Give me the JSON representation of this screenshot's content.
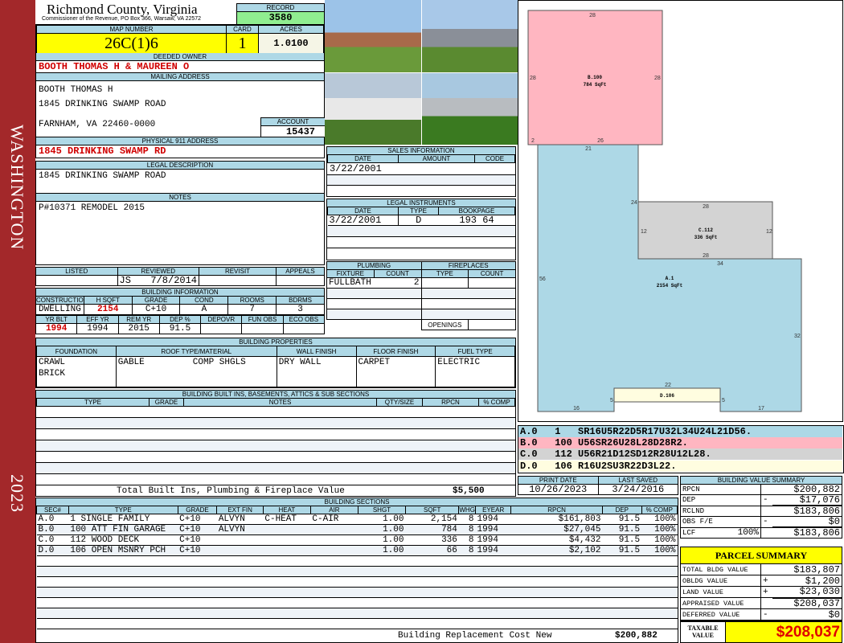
{
  "sidebar": {
    "district": "WASHINGTON",
    "year": "2023"
  },
  "header": {
    "title": "Richmond County, Virginia",
    "subtitle": "Commissioner of the Revenue, PO Box 366, Warsaw, VA 22572",
    "record_label": "RECORD",
    "record": "3580",
    "map_label": "MAP NUMBER",
    "map": "26C(1)6",
    "card_label": "CARD",
    "card": "1",
    "acres_label": "ACRES",
    "acres": "1.0100"
  },
  "owner": {
    "label": "DEEDED OWNER",
    "value": "BOOTH THOMAS H & MAUREEN O"
  },
  "mailing": {
    "label": "MAILING ADDRESS",
    "line1": "BOOTH THOMAS H",
    "line2": "1845 DRINKING SWAMP ROAD",
    "line3": "FARNHAM, VA 22460-0000",
    "account_label": "ACCOUNT",
    "account": "15437"
  },
  "physical": {
    "label": "PHYSICAL 911 ADDRESS",
    "value": "1845 DRINKING SWAMP RD"
  },
  "legal": {
    "label": "LEGAL DESCRIPTION",
    "value": "1845 DRINKING SWAMP ROAD"
  },
  "notes": {
    "label": "NOTES",
    "value": "P#10371 REMODEL 2015"
  },
  "review": {
    "headers": [
      "LISTED",
      "REVIEWED",
      "REVISIT",
      "APPEALS"
    ],
    "reviewer": "JS",
    "reviewed": "7/8/2014"
  },
  "building_info": {
    "label": "BUILDING INFORMATION",
    "h1": [
      "CONSTRUCTION STYLE",
      "H SQFT",
      "GRADE",
      "COND",
      "ROOMS",
      "BDRMS"
    ],
    "v1": [
      "DWELLING",
      "2154",
      "C+10",
      "A",
      "7",
      "3"
    ],
    "h2": [
      "YR BLT",
      "EFF YR",
      "REM YR",
      "DEP %",
      "DEPOVR",
      "FUN OBS",
      "ECO OBS"
    ],
    "v2": [
      "1994",
      "1994",
      "2015",
      "91.5",
      "",
      "",
      ""
    ]
  },
  "properties": {
    "label": "BUILDING PROPERTIES",
    "headers": [
      "FOUNDATION",
      "ROOF TYPE/MATERIAL",
      "WALL FINISH",
      "FLOOR FINISH",
      "FUEL TYPE"
    ],
    "foundation": [
      "CRAWL",
      "BRICK"
    ],
    "roof_type": "GABLE",
    "roof_material": "COMP SHGLS",
    "wall": "DRY WALL",
    "floor": "CARPET",
    "fuel": "ELECTRIC"
  },
  "builtins": {
    "label": "BUILDING BUILT INS, BASEMENTS, ATTICS & SUB SECTIONS",
    "headers": [
      "TYPE",
      "GRADE",
      "NOTES",
      "QTY/SIZE",
      "RPCN",
      "% COMP"
    ],
    "total_label": "Total Built Ins, Plumbing & Fireplace Value",
    "total": "$5,500"
  },
  "sales": {
    "label": "SALES INFORMATION",
    "headers": [
      "DATE",
      "AMOUNT",
      "CODE"
    ],
    "rows": [
      [
        "3/22/2001",
        "",
        ""
      ]
    ]
  },
  "instruments": {
    "label": "LEGAL INSTRUMENTS",
    "headers": [
      "DATE",
      "TYPE",
      "BOOKPAGE"
    ],
    "rows": [
      [
        "3/22/2001",
        "D",
        "193 64"
      ]
    ]
  },
  "plumbing": {
    "label": "PLUMBING",
    "headers": [
      "FIXTURE",
      "COUNT"
    ],
    "rows": [
      [
        "FULLBATH",
        "2"
      ]
    ]
  },
  "fireplaces": {
    "label": "FIREPLACES",
    "headers": [
      "TYPE",
      "COUNT"
    ],
    "openings_label": "OPENINGS"
  },
  "sections": {
    "label": "BUILDING SECTIONS",
    "headers": [
      "SEC#",
      "TYPE",
      "GRADE",
      "EXT FIN",
      "HEAT",
      "AIR",
      "SHGT",
      "SQFT",
      "WHGT",
      "EYEAR",
      "RPCN",
      "DEP",
      "% COMP"
    ],
    "rows": [
      [
        "A.0",
        "1 SINGLE FAMILY",
        "C+10",
        "ALVYN",
        "C-HEAT",
        "C-AIR",
        "1.00",
        "2,154",
        "8",
        "1994",
        "$161,803",
        "91.5",
        "100%"
      ],
      [
        "B.0",
        "100 ATT FIN GARAGE",
        "C+10",
        "ALVYN",
        "",
        "",
        "1.00",
        "784",
        "8",
        "1994",
        "$27,045",
        "91.5",
        "100%"
      ],
      [
        "C.0",
        "112 WOOD DECK",
        "C+10",
        "",
        "",
        "",
        "1.00",
        "336",
        "8",
        "1994",
        "$4,432",
        "91.5",
        "100%"
      ],
      [
        "D.0",
        "106 OPEN MSNRY PCH",
        "C+10",
        "",
        "",
        "",
        "1.00",
        "66",
        "8",
        "1994",
        "$2,102",
        "91.5",
        "100%"
      ]
    ],
    "rcn_label": "Building Replacement Cost New",
    "rcn": "$200,882"
  },
  "sketch": {
    "colors": {
      "A": "#add8e6",
      "B": "#ffb6c1",
      "C": "#d3d3d3",
      "D": "#fffde0"
    },
    "labels": {
      "A": [
        "A.1",
        "2154 SqFt"
      ],
      "B": [
        "B.100",
        "784 SqFt"
      ],
      "C": [
        "C.112",
        "336 SqFt"
      ],
      "D": [
        "D.106"
      ]
    },
    "dims": {
      "b_top": "28",
      "b_left": "28",
      "b_right": "28",
      "b_bot2": "2",
      "b_bot": "26",
      "a_top": "21",
      "a_24": "24",
      "c_top": "28",
      "c_left": "12",
      "c_right": "12",
      "c_bot": "28",
      "a_34": "34",
      "a_left": "56",
      "a_right": "32",
      "d_top": "22",
      "d_l": "5",
      "d_r": "5",
      "a_b1": "16",
      "a_b2": "17"
    },
    "legend": [
      [
        "A.0",
        "1",
        "SR16U5R22D5R17U32L34U24L21D56."
      ],
      [
        "B.0",
        "100",
        "U56SR26U28L28D28R2."
      ],
      [
        "C.0",
        "112",
        "U56R21D12SD12R28U12L28."
      ],
      [
        "D.0",
        "106",
        "R16U2SU3R22D3L22."
      ]
    ]
  },
  "dates": {
    "print_label": "PRINT DATE",
    "print": "10/26/2023",
    "saved_label": "LAST SAVED",
    "saved": "3/24/2016"
  },
  "value_summary": {
    "label": "BUILDING VALUE SUMMARY",
    "rows": [
      [
        "RPCN",
        "",
        "",
        "$200,882"
      ],
      [
        "DEP",
        "",
        "-",
        "$17,076"
      ],
      [
        "RCLND",
        "",
        "",
        "$183,806"
      ],
      [
        "OBS F/E",
        "",
        "-",
        "$0"
      ],
      [
        "LCF",
        "100%",
        "",
        "$183,806"
      ]
    ]
  },
  "parcel": {
    "label": "PARCEL SUMMARY",
    "rows": [
      [
        "TOTAL BLDG VALUE",
        "",
        "$183,807"
      ],
      [
        "OBLDG VALUE",
        "+",
        "$1,200"
      ],
      [
        "LAND VALUE",
        "+",
        "$23,030"
      ],
      [
        "APPRAISED VALUE",
        "",
        "$208,037"
      ],
      [
        "DEFERRED VALUE",
        "-",
        "$0"
      ]
    ],
    "taxable_label1": "TAXABLE",
    "taxable_label2": "VALUE",
    "taxable": "$208,037"
  }
}
